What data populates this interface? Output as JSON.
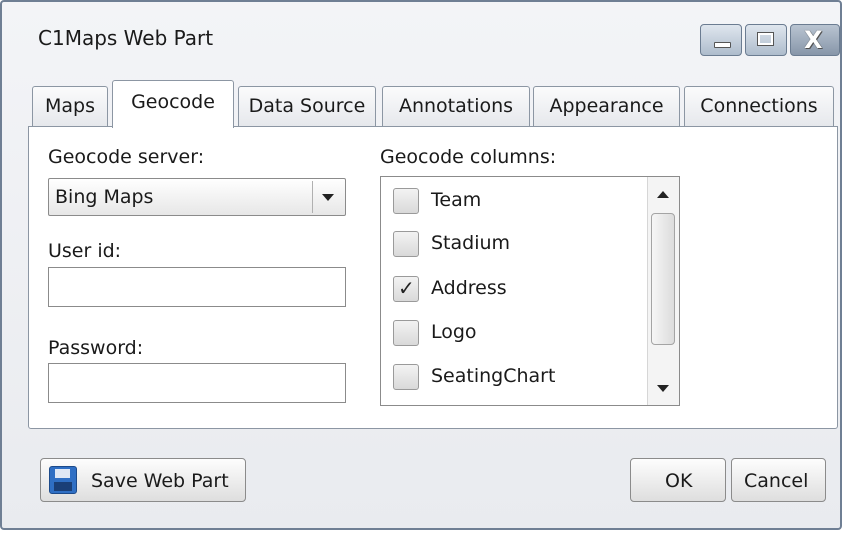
{
  "window": {
    "title": "C1Maps Web Part",
    "buttons": [
      "minimize",
      "maximize",
      "close"
    ],
    "close_glyph": "X"
  },
  "tabs": [
    {
      "label": "Maps",
      "active": false
    },
    {
      "label": "Geocode",
      "active": true
    },
    {
      "label": "Data Source",
      "active": false
    },
    {
      "label": "Annotations",
      "active": false
    },
    {
      "label": "Appearance",
      "active": false
    },
    {
      "label": "Connections",
      "active": false
    }
  ],
  "geocode": {
    "server_label": "Geocode server:",
    "server_value": "Bing Maps",
    "userid_label": "User id:",
    "userid_value": "",
    "password_label": "Password:",
    "password_value": "",
    "columns_label": "Geocode columns:",
    "columns": [
      {
        "label": "Team",
        "checked": false
      },
      {
        "label": "Stadium",
        "checked": false
      },
      {
        "label": "Address",
        "checked": true
      },
      {
        "label": "Logo",
        "checked": false
      },
      {
        "label": "SeatingChart",
        "checked": false
      }
    ],
    "check_glyph": "✓"
  },
  "footer": {
    "save_label": "Save Web Part",
    "ok_label": "OK",
    "cancel_label": "Cancel"
  },
  "icons": {
    "save": "floppy-disk-icon"
  }
}
